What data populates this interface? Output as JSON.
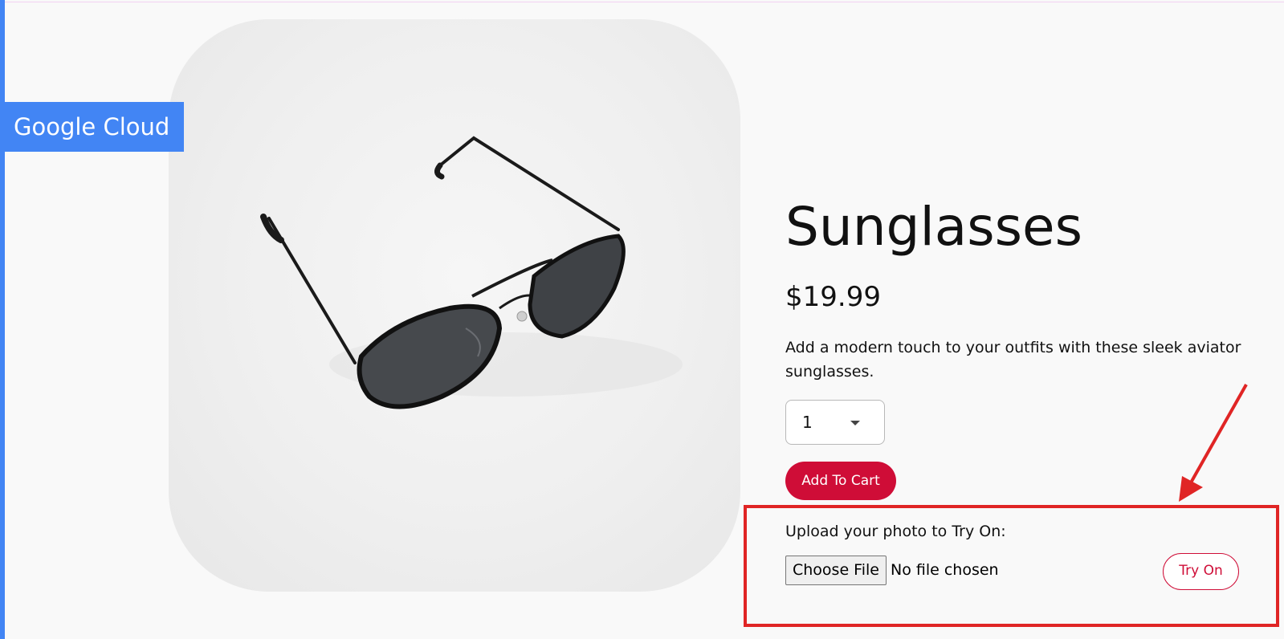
{
  "brand": {
    "name": "Google Cloud"
  },
  "product": {
    "name": "Sunglasses",
    "price": "$19.99",
    "description": "Add a modern touch to your outfits with these sleek aviator sunglasses.",
    "image_icon": "sunglasses-image"
  },
  "quantity": {
    "selected": "1"
  },
  "buttons": {
    "add_to_cart": "Add To Cart",
    "try_on": "Try On"
  },
  "upload": {
    "label": "Upload your photo to Try On:",
    "choose_file": "Choose File",
    "no_file": "No file chosen"
  },
  "colors": {
    "brand_blue": "#4285f4",
    "accent_red": "#cf0d37",
    "annotation_red": "#e02525",
    "background": "#f9f9f9"
  }
}
